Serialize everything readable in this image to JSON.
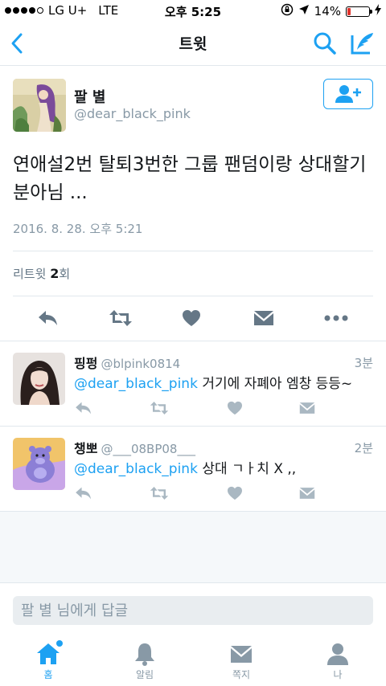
{
  "status_bar": {
    "carrier": "LG U+",
    "network": "LTE",
    "time": "오후 5:25",
    "battery_percent": "14%",
    "battery_level": 0.14,
    "signal_dots_filled": 4,
    "signal_dots_total": 5
  },
  "nav": {
    "title": "트윗"
  },
  "main_tweet": {
    "name": "팔 별",
    "handle": "@dear_black_pink",
    "text": "연애설2번 탈퇴3번한 그룹 팬덤이랑 상대할기분아님 ...",
    "timestamp": "2016. 8. 28. 오후 5:21",
    "retweets_label": "리트윗",
    "retweets_count": "2",
    "retweets_unit": "회"
  },
  "replies": [
    {
      "name": "핑펑",
      "handle": "@blpink0814",
      "time": "3분",
      "mention": "@dear_black_pink",
      "text": " 거기에 자폐아 엠창 등등~"
    },
    {
      "name": "챙뽀",
      "handle": "@___08BP08___",
      "time": "2분",
      "mention": "@dear_black_pink",
      "text": " 상대 ㄱㅏ치 X ,,"
    }
  ],
  "composer": {
    "placeholder": "팔 별 님에게 답글"
  },
  "tabs": [
    {
      "label": "홈",
      "icon": "home-icon",
      "active": true
    },
    {
      "label": "알림",
      "icon": "bell-icon",
      "active": false
    },
    {
      "label": "쪽지",
      "icon": "envelope-icon",
      "active": false
    },
    {
      "label": "나",
      "icon": "person-icon",
      "active": false
    }
  ],
  "colors": {
    "accent": "#1da1f2",
    "action_gray": "#657786",
    "reply_action_gray": "#aab8c2",
    "battery_low": "#e0322b"
  }
}
